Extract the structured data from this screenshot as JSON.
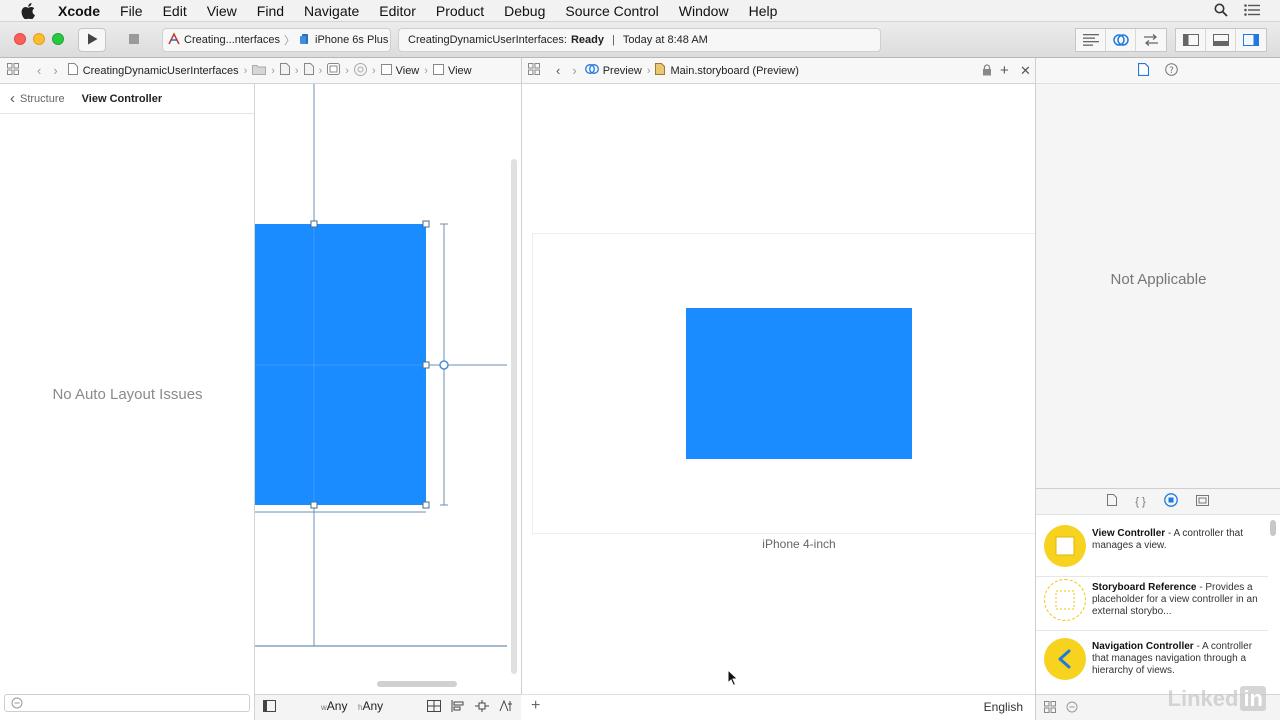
{
  "menubar": {
    "app_name": "Xcode",
    "items": [
      "File",
      "Edit",
      "View",
      "Find",
      "Navigate",
      "Editor",
      "Product",
      "Debug",
      "Source Control",
      "Window",
      "Help"
    ]
  },
  "toolbar": {
    "scheme_target": "Creating...nterfaces",
    "scheme_device": "iPhone 6s Plus",
    "status_project": "CreatingDynamicUserInterfaces:",
    "status_state": "Ready",
    "status_separator": "|",
    "status_time": "Today at 8:48 AM"
  },
  "left_jumpbar": {
    "project": "CreatingDynamicUserInterfaces",
    "view1": "View",
    "view2": "View"
  },
  "right_jumpbar": {
    "preview": "Preview",
    "file": "Main.storyboard (Preview)"
  },
  "issues_panel": {
    "back_label": "Structure",
    "title": "View Controller",
    "empty_message": "No Auto Layout Issues"
  },
  "canvas": {
    "size_class_w_prefix": "w",
    "size_class_w": "Any",
    "size_class_h_prefix": "h",
    "size_class_h": "Any"
  },
  "preview": {
    "device_label": "iPhone 4-inch",
    "language": "English"
  },
  "inspector": {
    "empty_message": "Not Applicable"
  },
  "library": {
    "items": [
      {
        "name": "View Controller",
        "description": " - A controller that manages a view."
      },
      {
        "name": "Storyboard Reference",
        "description": " - Provides a placeholder for a view controller in an external storybo..."
      },
      {
        "name": "Navigation Controller",
        "description": " - A controller that manages navigation through a hierarchy of views."
      }
    ]
  },
  "watermark": {
    "text": "Linked",
    "badge": "in"
  },
  "colors": {
    "view_blue": "#1a8cff",
    "library_yellow": "#f7d21e",
    "accent": "#1f7ae0"
  }
}
